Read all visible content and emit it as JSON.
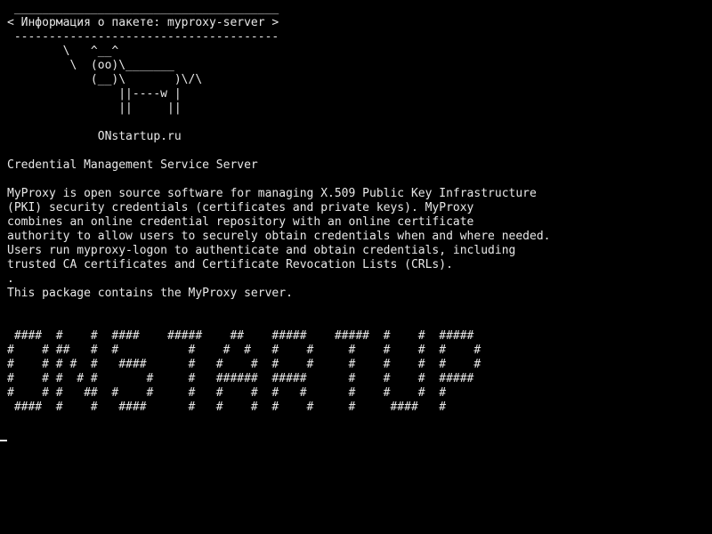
{
  "terminal": {
    "colors": {
      "background": "#000000",
      "foreground": "#e8e8e8"
    },
    "lines": [
      " ______________________________________",
      "< Информация о пакете: myproxy-server >",
      " --------------------------------------",
      "        \\   ^__^",
      "         \\  (oo)\\_______",
      "            (__)\\       )\\/\\",
      "                ||----w |",
      "                ||     ||",
      "",
      "             ONstartup.ru",
      "",
      "Credential Management Service Server",
      "",
      "MyProxy is open source software for managing X.509 Public Key Infrastructure",
      "(PKI) security credentials (certificates and private keys). MyProxy",
      "combines an online credential repository with an online certificate",
      "authority to allow users to securely obtain credentials when and where needed.",
      "Users run myproxy-logon to authenticate and obtain credentials, including",
      "trusted CA certificates and Certificate Revocation Lists (CRLs).",
      ".",
      "This package contains the MyProxy server.",
      "",
      "",
      " ####  #    #  ####    #####    ##    #####    #####  #    #  #####",
      "#    # ##   #  #          #    #  #   #    #     #    #    #  #    #",
      "#    # # #  #   ####      #   #    #  #    #     #    #    #  #    #",
      "#    # #  # #       #     #   ######  #####      #    #    #  #####",
      "#    # #   ##  #    #     #   #    #  #   #      #    #    #  #",
      " ####  #    #   ####      #   #    #  #    #     #     ####   #"
    ],
    "prompt": ""
  }
}
